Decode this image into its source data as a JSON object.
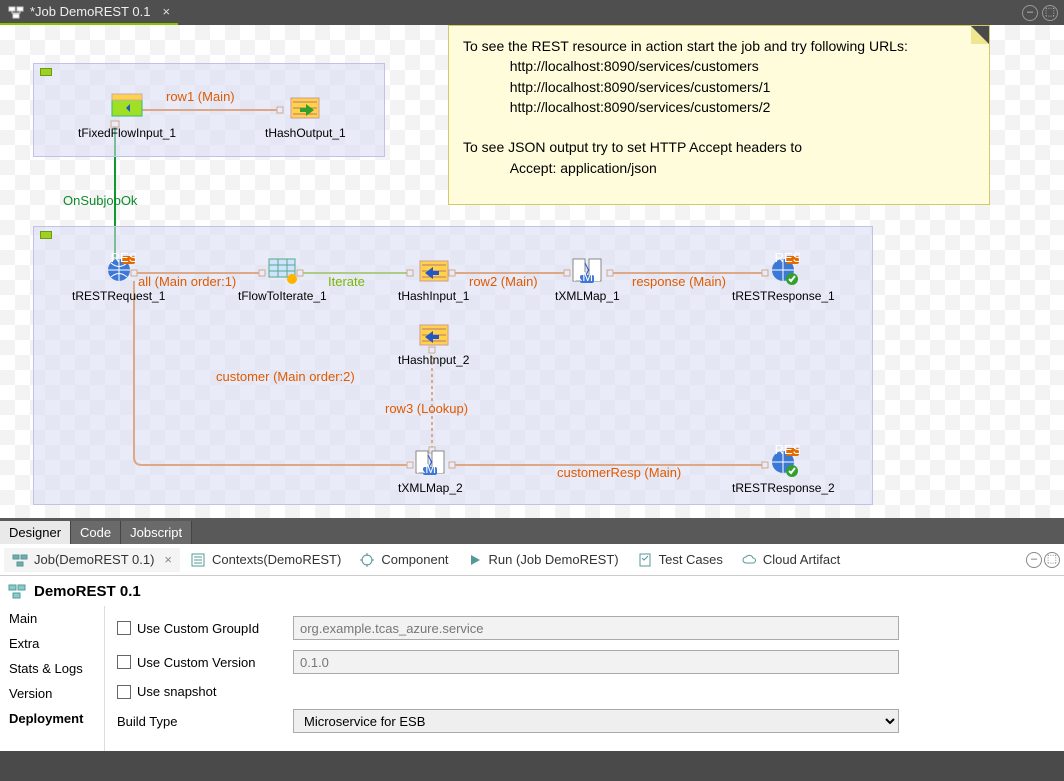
{
  "tab": {
    "title": "*Job DemoREST 0.1"
  },
  "note": {
    "text": "To see the REST resource in action start the job and try following URLs:\n            http://localhost:8090/services/customers\n            http://localhost:8090/services/customers/1\n            http://localhost:8090/services/customers/2\n\nTo see JSON output try to set HTTP Accept headers to\n            Accept: application/json"
  },
  "nodes": {
    "n1": "tFixedFlowInput_1",
    "n2": "tHashOutput_1",
    "n3": "tRESTRequest_1",
    "n4": "tFlowToIterate_1",
    "n5": "tHashInput_1",
    "n6": "tXMLMap_1",
    "n7": "tRESTResponse_1",
    "n8": "tHashInput_2",
    "n9": "tXMLMap_2",
    "n10": "tRESTResponse_2"
  },
  "edges": {
    "row1": "row1 (Main)",
    "onsub": "OnSubjobOk",
    "all": "all (Main order:1)",
    "iterate": "Iterate",
    "row2": "row2 (Main)",
    "response": "response (Main)",
    "customer": "customer (Main order:2)",
    "row3": "row3 (Lookup)",
    "custresp": "customerResp (Main)"
  },
  "designTabs": {
    "t1": "Designer",
    "t2": "Code",
    "t3": "Jobscript"
  },
  "views": {
    "v1": "Job(DemoREST 0.1)",
    "v2": "Contexts(DemoREST)",
    "v3": "Component",
    "v4": "Run (Job DemoREST)",
    "v5": "Test Cases",
    "v6": "Cloud Artifact"
  },
  "subheader": "DemoREST 0.1",
  "leftTabs": {
    "l1": "Main",
    "l2": "Extra",
    "l3": "Stats & Logs",
    "l4": "Version",
    "l5": "Deployment"
  },
  "form": {
    "useGroupId_label": "Use Custom GroupId",
    "groupId_value": "org.example.tcas_azure.service",
    "useVersion_label": "Use Custom Version",
    "version_value": "0.1.0",
    "snapshot_label": "Use snapshot",
    "buildType_label": "Build Type",
    "buildType_value": "Microservice for ESB"
  }
}
